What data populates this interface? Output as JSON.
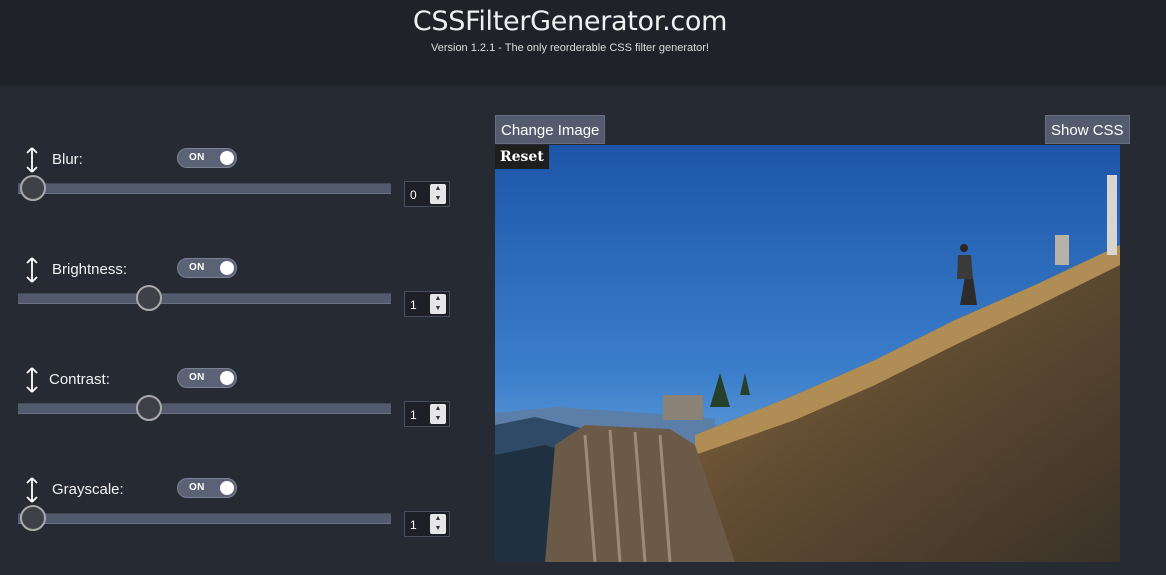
{
  "header": {
    "title": "CSSFilterGenerator.com",
    "subtitle": "Version 1.2.1 - The only reorderable CSS filter generator!"
  },
  "filters": [
    {
      "label": "Blur:",
      "toggle": "ON",
      "value": "0",
      "slider_fraction": 0.04
    },
    {
      "label": "Brightness:",
      "toggle": "ON",
      "value": "1",
      "slider_fraction": 0.35
    },
    {
      "label": "Contrast:",
      "toggle": "ON",
      "value": "1",
      "slider_fraction": 0.35
    },
    {
      "label": "Grayscale:",
      "toggle": "ON",
      "value": "1",
      "slider_fraction": 0.04
    }
  ],
  "toolbar": {
    "change_image": "Change Image",
    "show_css": "Show CSS",
    "reset": "Reset"
  },
  "icons": {
    "drag": "up-down-arrow-icon",
    "spinner_up": "chevron-up-icon",
    "spinner_down": "chevron-down-icon"
  },
  "colors": {
    "background": "#262a33",
    "header": "#1f2229",
    "button": "#555b6e"
  }
}
